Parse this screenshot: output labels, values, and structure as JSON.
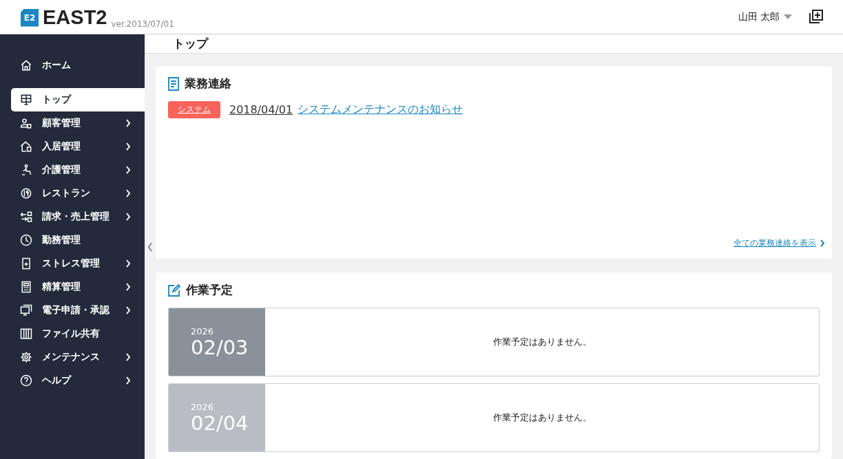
{
  "header": {
    "logo_mark": "E2",
    "logo_text": "EAST2",
    "version": "ver.2013/07/01",
    "user": "山田 太郎"
  },
  "sidebar": {
    "items": [
      {
        "label": "ホーム",
        "selected": false,
        "expandable": false
      },
      {
        "label": "トップ",
        "selected": true,
        "expandable": false
      },
      {
        "label": "顧客管理",
        "selected": false,
        "expandable": true
      },
      {
        "label": "入居管理",
        "selected": false,
        "expandable": true
      },
      {
        "label": "介護管理",
        "selected": false,
        "expandable": true
      },
      {
        "label": "レストラン",
        "selected": false,
        "expandable": true
      },
      {
        "label": "請求・売上管理",
        "selected": false,
        "expandable": true
      },
      {
        "label": "勤務管理",
        "selected": false,
        "expandable": false
      },
      {
        "label": "ストレス管理",
        "selected": false,
        "expandable": true
      },
      {
        "label": "精算管理",
        "selected": false,
        "expandable": true
      },
      {
        "label": "電子申請・承認",
        "selected": false,
        "expandable": true
      },
      {
        "label": "ファイル共有",
        "selected": false,
        "expandable": false
      },
      {
        "label": "メンテナンス",
        "selected": false,
        "expandable": true
      },
      {
        "label": "ヘルプ",
        "selected": false,
        "expandable": true
      }
    ]
  },
  "page_title": "トップ",
  "notices": {
    "title": "業務連絡",
    "items": [
      {
        "tag": "システム",
        "color": "#f7635a",
        "date": "2018/04/01",
        "text": "システムメンテナンスのお知らせ"
      }
    ],
    "more_link": "全ての業務連絡を表示"
  },
  "schedule": {
    "title": "作業予定",
    "days": [
      {
        "year": "2026",
        "date": "02/03",
        "message": "作業予定はありません。",
        "current": true
      },
      {
        "year": "2026",
        "date": "02/04",
        "message": "作業予定はありません。",
        "current": false
      }
    ]
  }
}
